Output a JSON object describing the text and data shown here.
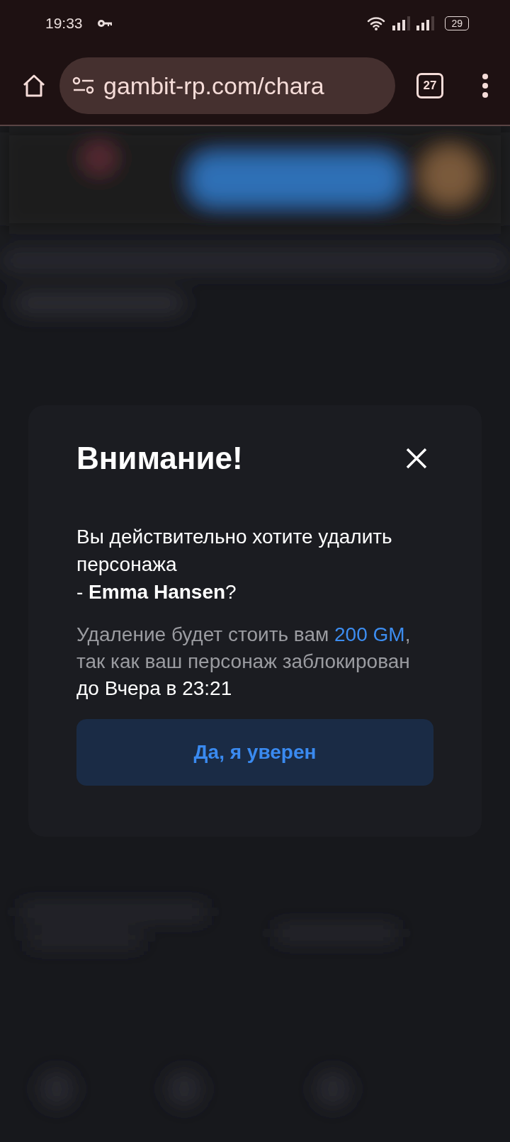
{
  "status_bar": {
    "time": "19:33",
    "battery": "29"
  },
  "browser": {
    "url": "gambit-rp.com/chara",
    "tab_count": "27"
  },
  "dialog": {
    "title": "Внимание!",
    "message_lines": [
      "Вы действительно хотите удалить персонажа",
      "- **Emma Hansen**?"
    ],
    "cost_segments": [
      {
        "kind": "muted",
        "text": "Удаление будет стоить вам "
      },
      {
        "kind": "accent",
        "text": "200 GM"
      },
      {
        "kind": "muted",
        "text": ", так как ваш персонаж заблокирован "
      },
      {
        "kind": "strong",
        "text": "до Вчера в 23:21"
      }
    ],
    "confirm_button": "Да, я уверен"
  }
}
